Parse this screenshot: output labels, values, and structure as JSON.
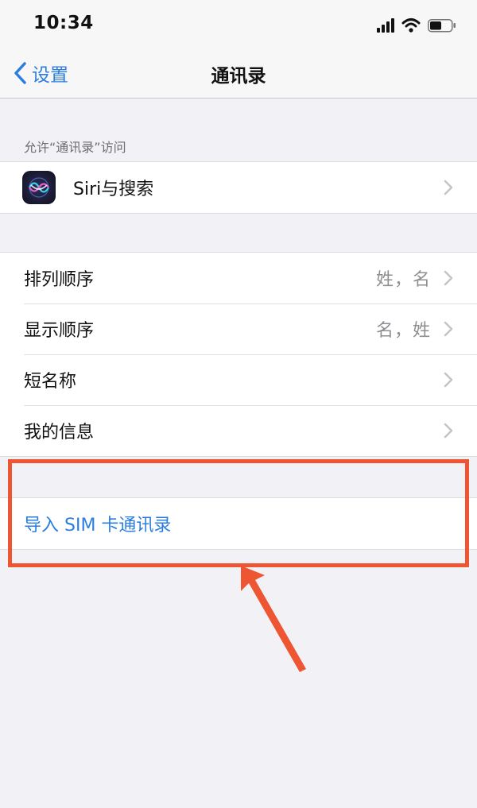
{
  "status_bar": {
    "time": "10:34"
  },
  "nav": {
    "back_label": "设置",
    "title": "通讯录"
  },
  "access_section": {
    "header": "允许“通讯录”访问",
    "siri_label": "Siri与搜索"
  },
  "settings_rows": [
    {
      "label": "排列顺序",
      "value": "姓，名"
    },
    {
      "label": "显示顺序",
      "value": "名，姓"
    },
    {
      "label": "短名称",
      "value": ""
    },
    {
      "label": "我的信息",
      "value": ""
    }
  ],
  "sim_import": {
    "label": "导入 SIM 卡通讯录"
  },
  "colors": {
    "accent": "#2a7de1",
    "annotation": "#ee5533",
    "background": "#f2f1f6"
  },
  "icons": [
    "chevron-left-icon",
    "chevron-right-icon",
    "siri-icon",
    "cellular-signal-icon",
    "wifi-icon",
    "battery-icon",
    "annotation-arrow-icon"
  ]
}
